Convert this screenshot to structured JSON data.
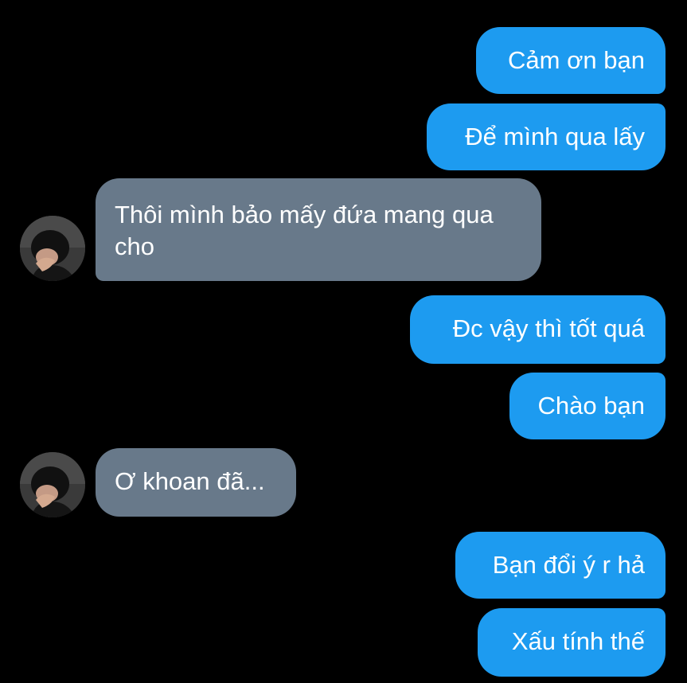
{
  "colors": {
    "background": "#000000",
    "sent_bubble": "#1d9bf0",
    "received_bubble": "#68798a",
    "text": "#ffffff"
  },
  "messages": [
    {
      "from": "me",
      "text": "Cảm ơn bạn"
    },
    {
      "from": "me",
      "text": "Để mình qua lấy"
    },
    {
      "from": "other",
      "text": "Thôi mình bảo mấy đứa mang qua cho",
      "avatar": "contact-avatar-photo"
    },
    {
      "from": "me",
      "text": "Đc vậy thì tốt quá"
    },
    {
      "from": "me",
      "text": "Chào bạn"
    },
    {
      "from": "other",
      "text": "Ơ khoan đã...",
      "avatar": "contact-avatar-photo"
    },
    {
      "from": "me",
      "text": "Bạn đổi ý r hả"
    },
    {
      "from": "me",
      "text": "Xấu tính thế"
    }
  ]
}
